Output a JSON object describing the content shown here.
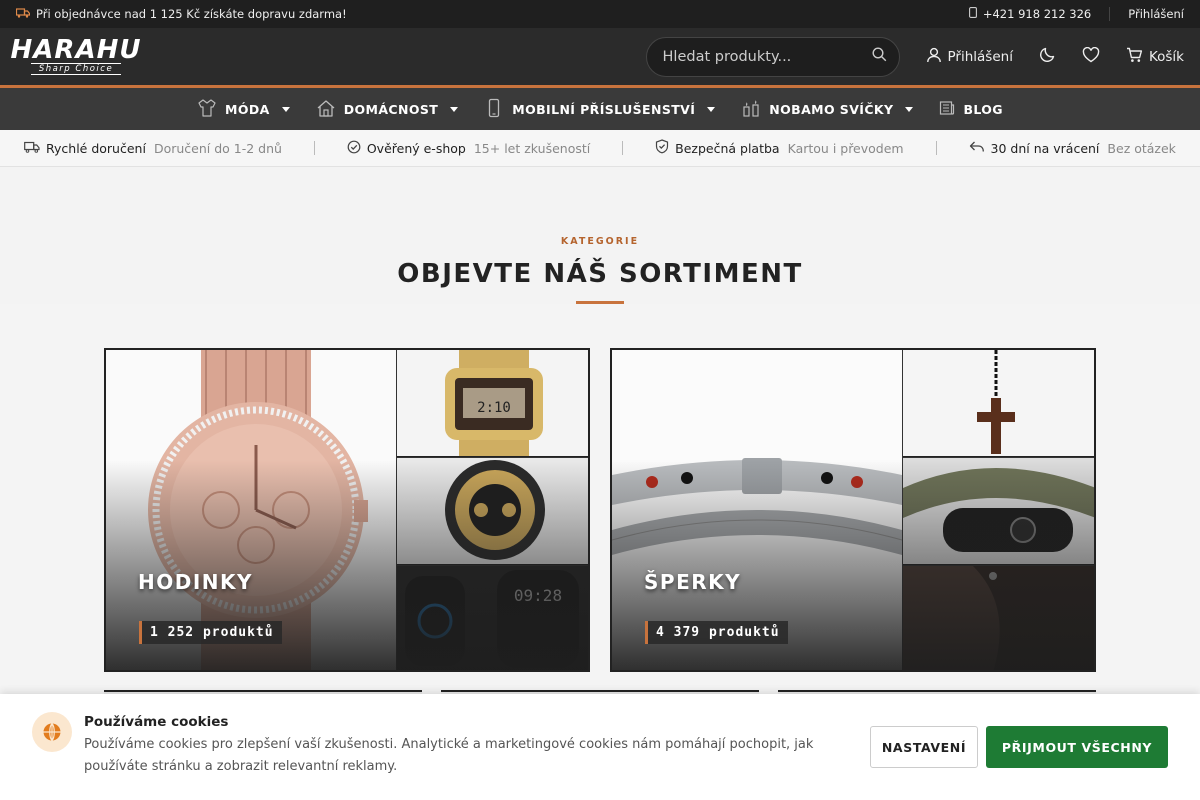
{
  "topbar": {
    "promo": "Při objednávce nad 1 125 Kč získáte dopravu zdarma!",
    "phone": "+421 918 212 326",
    "login": "Přihlášení"
  },
  "header": {
    "logo_main": "HARAHU",
    "logo_sub": "Sharp Choice",
    "search_placeholder": "Hledat produkty...",
    "login": "Přihlášení",
    "cart": "Košík"
  },
  "nav": [
    {
      "label": "MÓDA",
      "icon": "clothing-icon",
      "dropdown": true
    },
    {
      "label": "DOMÁCNOST",
      "icon": "house-icon",
      "dropdown": true
    },
    {
      "label": "MOBILNÍ PŘÍSLUŠENSTVÍ",
      "icon": "phone-icon",
      "dropdown": true
    },
    {
      "label": "NOBAMO SVÍČKY",
      "icon": "candle-icon",
      "dropdown": true
    },
    {
      "label": "BLOG",
      "icon": "newspaper-icon",
      "dropdown": false
    }
  ],
  "usp": [
    {
      "title": "Rychlé doručení",
      "sub": "Doručení do 1-2 dnů",
      "icon": "truck-icon"
    },
    {
      "title": "Ověřený e-shop",
      "sub": "15+ let zkušeností",
      "icon": "check-circle-icon"
    },
    {
      "title": "Bezpečná platba",
      "sub": "Kartou i převodem",
      "icon": "shield-check-icon"
    },
    {
      "title": "30 dní na vrácení",
      "sub": "Bez otázek",
      "icon": "return-arrow-icon"
    }
  ],
  "section": {
    "kicker": "KATEGORIE",
    "title": "OBJEVTE NÁŠ SORTIMENT"
  },
  "categories": [
    {
      "name": "HODINKY",
      "count": "1 252 produktů"
    },
    {
      "name": "ŠPERKY",
      "count": "4 379 produktů"
    }
  ],
  "cookie": {
    "title": "Používáme cookies",
    "body": "Používáme cookies pro zlepšení vaší zkušenosti. Analytické a marketingové cookies nám pomáhají pochopit, jak používáte stránku a zobrazit relevantní reklamy.",
    "settings": "NASTAVENÍ",
    "accept": "PŘIJMOUT VŠECHNY"
  },
  "colors": {
    "accent": "#c8733d",
    "accept_green": "#1e7b34",
    "dark_header": "#2b2b2b"
  }
}
